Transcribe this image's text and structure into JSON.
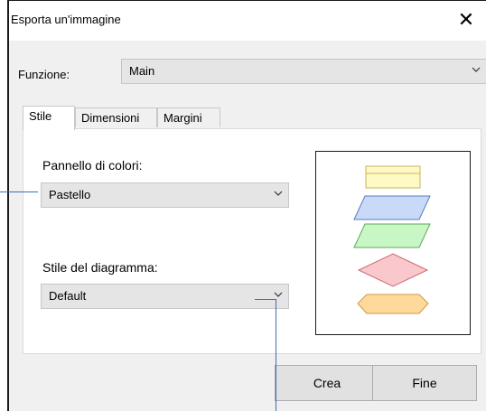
{
  "window": {
    "title": "Esporta un'immagine",
    "close_glyph": "✕"
  },
  "function": {
    "label": "Funzione:",
    "value": "Main"
  },
  "tabs": [
    {
      "label": "Stile",
      "active": true
    },
    {
      "label": "Dimensioni",
      "active": false
    },
    {
      "label": "Margini",
      "active": false
    }
  ],
  "palette": {
    "label": "Pannello di colori:",
    "value": "Pastello"
  },
  "diagram_style": {
    "label": "Stile del diagramma:",
    "value": "Default"
  },
  "preview": {
    "shapes": [
      {
        "name": "rectangle",
        "fill": "#fff9c4",
        "stroke": "#c9b45a"
      },
      {
        "name": "parallelogram",
        "fill": "#c9daf8",
        "stroke": "#5b7bbf"
      },
      {
        "name": "parallelogram",
        "fill": "#c8f7c5",
        "stroke": "#5caa5a"
      },
      {
        "name": "diamond",
        "fill": "#f8c8cc",
        "stroke": "#cc6a72"
      },
      {
        "name": "hexagon",
        "fill": "#ffd89b",
        "stroke": "#d19a3f"
      }
    ]
  },
  "buttons": {
    "create": "Crea",
    "finish": "Fine"
  },
  "colors": {
    "accent": "#3a6fb7"
  }
}
